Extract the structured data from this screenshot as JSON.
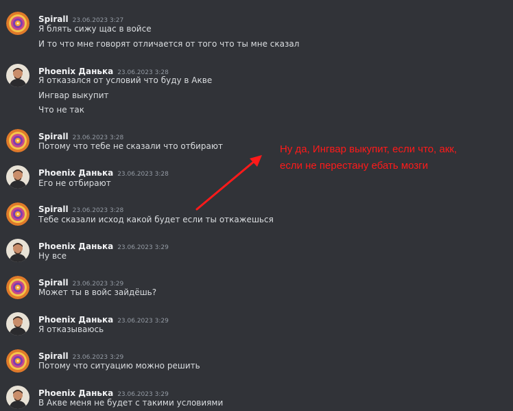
{
  "messages": [
    {
      "author": "Spirall",
      "time": "23.06.2023 3:27",
      "avatar": "spiral-avatar-icon",
      "lines": [
        "Я блять сижу щас в войсе",
        "И то что мне говорят отличается от того что ты мне сказал"
      ]
    },
    {
      "author": "Phoenix Данька",
      "time": "23.06.2023 3:28",
      "avatar": "person-avatar-icon",
      "lines": [
        "Я отказался от условий что буду в Акве",
        "Ингвар выкупит",
        "Что не так"
      ]
    },
    {
      "author": "Spirall",
      "time": "23.06.2023 3:28",
      "avatar": "spiral-avatar-icon",
      "lines": [
        "Потому что тебе не сказали что отбирают"
      ]
    },
    {
      "author": "Phoenix Данька",
      "time": "23.06.2023 3:28",
      "avatar": "person-avatar-icon",
      "lines": [
        "Его не отбирают"
      ]
    },
    {
      "author": "Spirall",
      "time": "23.06.2023 3:28",
      "avatar": "spiral-avatar-icon",
      "lines": [
        "Тебе сказали исход какой будет если ты откажешься"
      ]
    },
    {
      "author": "Phoenix Данька",
      "time": "23.06.2023 3:29",
      "avatar": "person-avatar-icon",
      "lines": [
        "Ну все"
      ]
    },
    {
      "author": "Spirall",
      "time": "23.06.2023 3:29",
      "avatar": "spiral-avatar-icon",
      "lines": [
        "Может ты в войс зайдёшь?"
      ]
    },
    {
      "author": "Phoenix Данька",
      "time": "23.06.2023 3:29",
      "avatar": "person-avatar-icon",
      "lines": [
        "Я отказываюсь"
      ]
    },
    {
      "author": "Spirall",
      "time": "23.06.2023 3:29",
      "avatar": "spiral-avatar-icon",
      "lines": [
        "Потому что ситуацию можно решить"
      ]
    },
    {
      "author": "Phoenix Данька",
      "time": "23.06.2023 3:29",
      "avatar": "person-avatar-icon",
      "lines": [
        "В Акве меня не будет с такими условиями"
      ]
    }
  ],
  "annotation": {
    "lines": [
      "Ну да, Ингвар выкупит, если что, акк,",
      "если не перестану ебать мозги"
    ],
    "color": "#ff1a1a",
    "arrow_icon": "red-arrow-icon"
  },
  "colors": {
    "background": "#313338",
    "username": "#f2f3f5",
    "timestamp": "#949ba4",
    "message_text": "#dbdee1"
  }
}
